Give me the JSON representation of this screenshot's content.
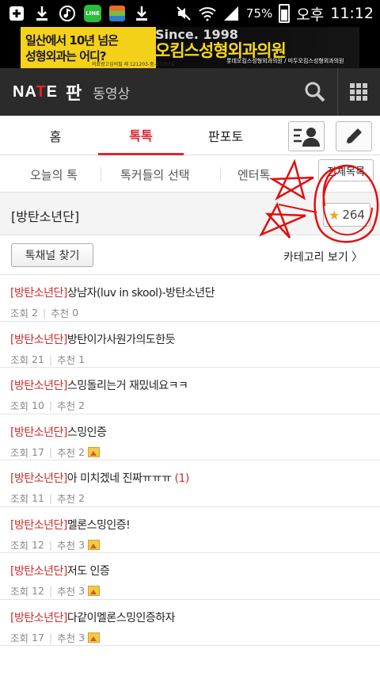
{
  "status_bar": {
    "battery": "75%",
    "ampm": "오후",
    "time": "11:12",
    "line_app": "LINE"
  },
  "ad": {
    "line1": "일산에서 10년 넘은",
    "line2": "성형외과는 어디?",
    "since": "Since. 1998",
    "title": "오킴스성형외과의원",
    "small": "의료광고심의필 제 121203-중-37203호",
    "sub": "롯데오킴스성형외과의원 / 미두오킴스성형외과의원"
  },
  "header": {
    "logo_na": "NA",
    "logo_t": "T",
    "logo_e": "E",
    "pann": "판",
    "video": "동영상"
  },
  "tabs": {
    "home": "홈",
    "talk": "톡톡",
    "pann_photo": "판포토"
  },
  "subtabs": {
    "today": "오늘의 톡",
    "talkers": "톡커들의 선택",
    "enter": "엔터톡",
    "all_menu": "전체목록"
  },
  "channel": {
    "name": "[방탄소년단]",
    "star_count": "264",
    "find_button": "톡채널 찾기",
    "category_link": "카테고리 보기 〉"
  },
  "labels": {
    "views": "조회",
    "recommend": "추천"
  },
  "posts": [
    {
      "channel": "[방탄소년단]",
      "title": "상남자(luv in skool)-방탄소년단",
      "views": "2",
      "recs": "0",
      "comments": "",
      "has_image": false
    },
    {
      "channel": "[방탄소년단]",
      "title": "방탄이가사원가의도한듯",
      "views": "21",
      "recs": "1",
      "comments": "",
      "has_image": false
    },
    {
      "channel": "[방탄소년단]",
      "title": "스밍돌리는거 재밌네요ㅋㅋ",
      "views": "10",
      "recs": "2",
      "comments": "",
      "has_image": false
    },
    {
      "channel": "[방탄소년단]",
      "title": "스밍인증",
      "views": "17",
      "recs": "2",
      "comments": "",
      "has_image": true
    },
    {
      "channel": "[방탄소년단]",
      "title": "아 미치겠네 진짜ㅠㅠㅠ",
      "views": "11",
      "recs": "2",
      "comments": "(1)",
      "has_image": false
    },
    {
      "channel": "[방탄소년단]",
      "title": "멜론스밍인증!",
      "views": "12",
      "recs": "3",
      "comments": "",
      "has_image": true
    },
    {
      "channel": "[방탄소년단]",
      "title": "저도 인증",
      "views": "12",
      "recs": "3",
      "comments": "",
      "has_image": true
    },
    {
      "channel": "[방탄소년단]",
      "title": "다같이멜론스밍인증하자",
      "views": "17",
      "recs": "3",
      "comments": "",
      "has_image": true
    }
  ],
  "colors": {
    "accent": "#e0252f",
    "header_bg": "#2b2b2b",
    "star": "#f3a21d",
    "scribble": "#e01010"
  }
}
